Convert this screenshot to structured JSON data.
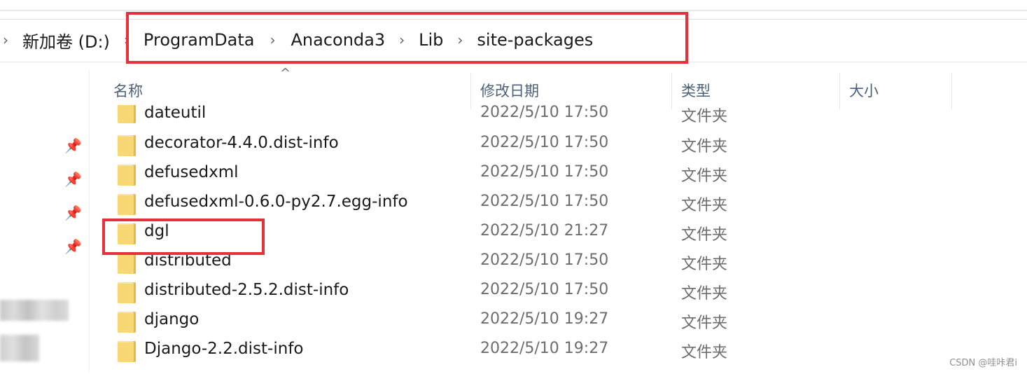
{
  "address_bar": {
    "crumbs": [
      "新加卷 (D:)",
      "ProgramData",
      "Anaconda3",
      "Lib",
      "site-packages"
    ]
  },
  "columns": {
    "name": "名称",
    "date_modified": "修改日期",
    "type": "类型",
    "size": "大小"
  },
  "files": [
    {
      "name": "dateutil",
      "date": "2022/5/10 17:50",
      "type": "文件夹"
    },
    {
      "name": "decorator-4.4.0.dist-info",
      "date": "2022/5/10 17:50",
      "type": "文件夹"
    },
    {
      "name": "defusedxml",
      "date": "2022/5/10 17:50",
      "type": "文件夹"
    },
    {
      "name": "defusedxml-0.6.0-py2.7.egg-info",
      "date": "2022/5/10 17:50",
      "type": "文件夹"
    },
    {
      "name": "dgl",
      "date": "2022/5/10 21:27",
      "type": "文件夹"
    },
    {
      "name": "distributed",
      "date": "2022/5/10 17:50",
      "type": "文件夹"
    },
    {
      "name": "distributed-2.5.2.dist-info",
      "date": "2022/5/10 17:50",
      "type": "文件夹"
    },
    {
      "name": "django",
      "date": "2022/5/10 19:27",
      "type": "文件夹"
    },
    {
      "name": "Django-2.2.dist-info",
      "date": "2022/5/10 19:27",
      "type": "文件夹"
    }
  ],
  "watermark": "CSDN @哇咔君i",
  "colors": {
    "annotation": "#e5323a",
    "folder": "#f8d775",
    "header_text": "#4c607a"
  },
  "icons": {
    "folder": "folder-icon",
    "pin": "pin-icon",
    "chevron": "chevron-right-icon"
  }
}
